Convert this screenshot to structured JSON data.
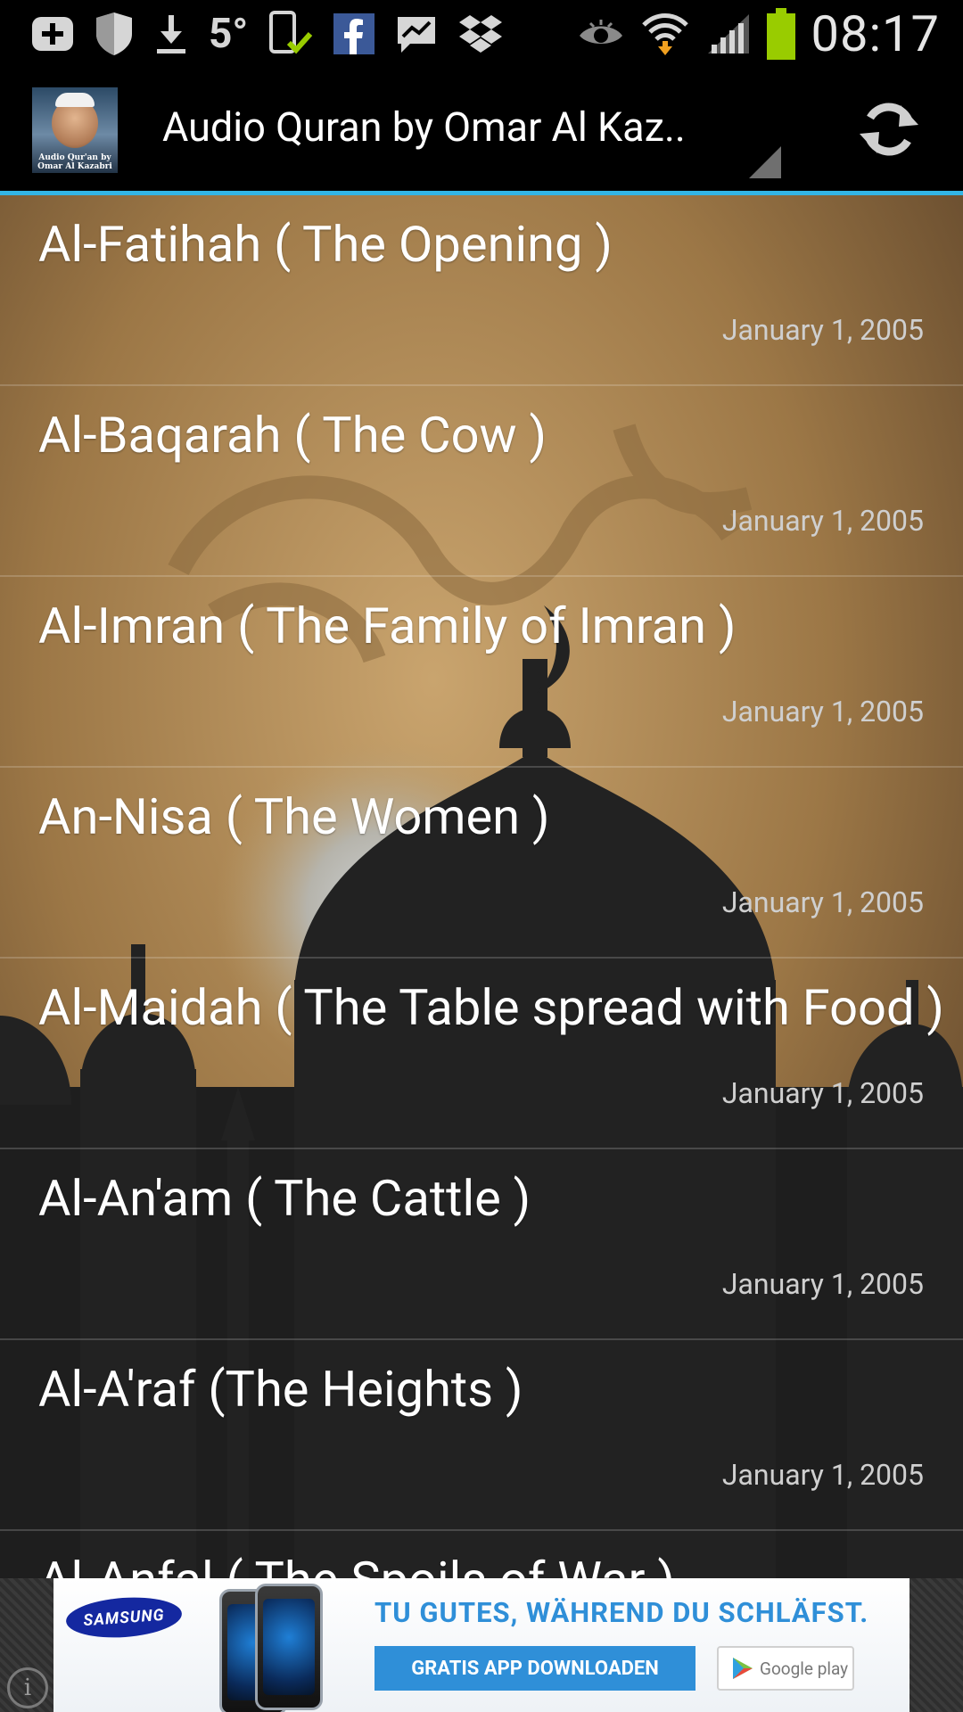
{
  "status_bar": {
    "temperature": "5°",
    "time": "08:17",
    "left_icons": [
      "add-icon",
      "shield-icon",
      "download-icon",
      "phone-check-icon",
      "facebook-icon",
      "messenger-icon",
      "dropbox-icon"
    ],
    "right_icons": [
      "eye-icon",
      "wifi-icon",
      "signal-icon",
      "battery-icon"
    ],
    "battery_color": "#99cc00"
  },
  "action_bar": {
    "app_icon_caption": "Audio Qur'an by Omar Al Kazabri",
    "title": "Audio Quran by Omar Al Kaz..",
    "refresh_icon": "refresh-icon",
    "accent_color": "#33b5e5"
  },
  "list": {
    "items": [
      {
        "title": "Al-Fatihah ( The Opening )",
        "date": "January 1, 2005"
      },
      {
        "title": "Al-Baqarah ( The Cow )",
        "date": "January 1, 2005"
      },
      {
        "title": "Al-Imran ( The Family of Imran )",
        "date": "January 1, 2005"
      },
      {
        "title": "An-Nisa ( The Women )",
        "date": "January 1, 2005"
      },
      {
        "title": "Al-Maidah ( The Table spread with Food )",
        "date": "January 1, 2005"
      },
      {
        "title": "Al-An'am ( The Cattle )",
        "date": "January 1, 2005"
      },
      {
        "title": "Al-A'raf (The Heights )",
        "date": "January 1, 2005"
      },
      {
        "title": "Al-Anfal ( The Spoils of War )",
        "date": ""
      }
    ]
  },
  "ad": {
    "brand": "SAMSUNG",
    "headline": "TU GUTES, WÄHREND DU SCHLÄFST.",
    "cta": "GRATIS APP DOWNLOADEN",
    "store_badge": "Google play",
    "info_icon": "i"
  }
}
